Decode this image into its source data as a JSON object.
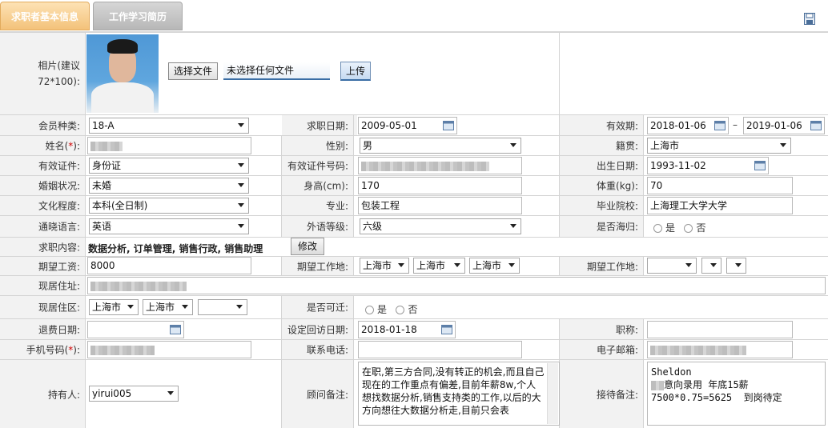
{
  "tabs": {
    "basic_info": "求职者基本信息",
    "resume": "工作学习简历"
  },
  "photo": {
    "label": "相片(建议",
    "label2": "72*100):",
    "choose_file": "选择文件",
    "no_file": "未选择任何文件",
    "upload": "上传"
  },
  "labels": {
    "member_type": "会员种类:",
    "job_date": "求职日期:",
    "valid_period": "有效期:",
    "name": "姓名(",
    "name_req": "*",
    "name_end": "):",
    "gender": "性别:",
    "native_place": "籍贯:",
    "id_type": "有效证件:",
    "id_number": "有效证件号码:",
    "birth_date": "出生日期:",
    "marital": "婚姻状况:",
    "height": "身高(cm):",
    "weight": "体重(kg):",
    "education": "文化程度:",
    "major": "专业:",
    "school": "毕业院校:",
    "language": "通晓语言:",
    "lang_level": "外语等级:",
    "returnee": "是否海归:",
    "job_content": "求职内容:",
    "salary": "期望工资:",
    "work_place": "期望工作地:",
    "work_place2": "期望工作地:",
    "address": "现居住址:",
    "district": "现居住区:",
    "relocate": "是否可迁:",
    "refund_date": "退费日期:",
    "visit_date": "设定回访日期:",
    "title": "职称:",
    "mobile": "手机号码(",
    "mobile_req": "*",
    "mobile_end": "):",
    "phone": "联系电话:",
    "email": "电子邮箱:",
    "holder": "持有人:",
    "consultant_note": "顾问备注:",
    "reception_note": "接待备注:"
  },
  "values": {
    "member_type": "18-A",
    "job_date": "2009-05-01",
    "valid_from": "2018-01-06",
    "valid_dash": "–",
    "valid_to": "2019-01-06",
    "gender": "男",
    "native_place": "上海市",
    "id_type": "身份证",
    "birth_date": "1993-11-02",
    "marital": "未婚",
    "height": "170",
    "weight": "70",
    "education": "本科(全日制)",
    "major": "包装工程",
    "school": "上海理工大学大学",
    "language": "英语",
    "lang_level": "六级",
    "yes": "是",
    "no": "否",
    "job_content": "数据分析, 订单管理, 销售行政, 销售助理",
    "modify": "修改",
    "salary": "8000",
    "work_city1": "上海市",
    "work_city2": "上海市",
    "work_city3": "上海市",
    "district_city1": "上海市",
    "district_city2": "上海市",
    "visit_date": "2018-01-18",
    "holder": "yirui005",
    "consultant_note": "在职,第三方合同,没有转正的机会,而且自己现在的工作重点有偏差,目前年薪8w,个人想找数据分析,销售支持类的工作,以后的大方向想往大数据分析走,目前只会表",
    "reception_note_line1": "Sheldon",
    "reception_note_line2": "意向录用 年底15薪",
    "reception_note_line3": "7500*0.75=5625  到岗待定"
  },
  "icons": {
    "save": "save-disk-icon",
    "calendar": "calendar-icon",
    "dropdown": "chevron-down-icon"
  },
  "colors": {
    "active_tab": "#f3c27a",
    "inactive_tab": "#b7b7b7",
    "label_bg": "#f2f2f2",
    "required": "#d00000"
  }
}
